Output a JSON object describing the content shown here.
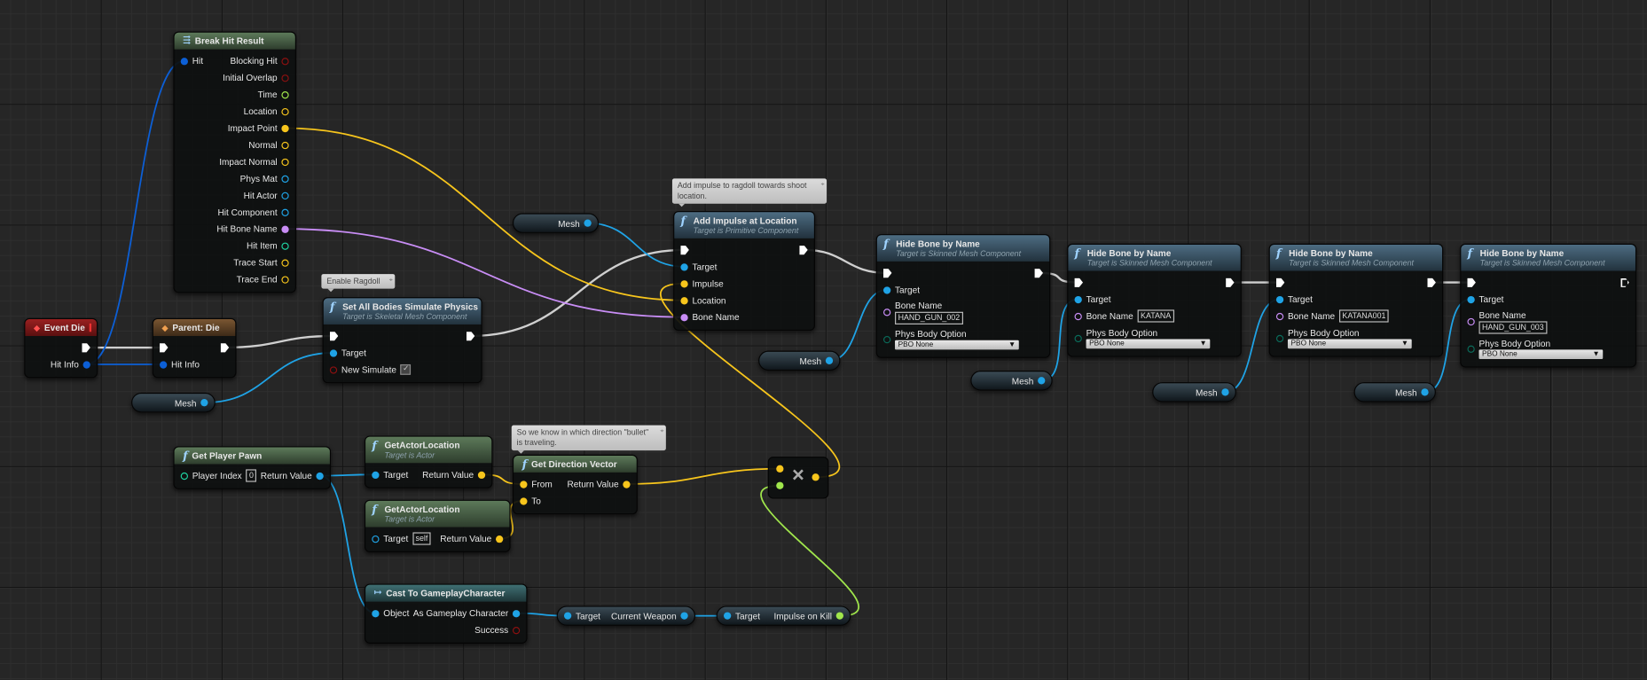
{
  "pin_colors": {
    "exec": "#ffffff",
    "struct": "#0c5fd6",
    "object": "#1fa3e6",
    "vector": "#f7c51c",
    "name": "#c88df5",
    "float": "#a0e64c",
    "bool": "#8b1010",
    "int": "#1fd1a0",
    "enum": "#0a6b5a"
  },
  "nodes": [
    {
      "id": "brk",
      "kind": "pure",
      "icon": "break-struct-icon",
      "title": "Break Hit Result",
      "subtitle": "",
      "inputs": [
        {
          "label": "Hit",
          "type": "struct",
          "filled": true
        }
      ],
      "outputs": [
        {
          "label": "Blocking Hit",
          "type": "bool"
        },
        {
          "label": "Initial Overlap",
          "type": "bool"
        },
        {
          "label": "Time",
          "type": "float"
        },
        {
          "label": "Location",
          "type": "vector"
        },
        {
          "label": "Impact Point",
          "type": "vector",
          "filled": true
        },
        {
          "label": "Normal",
          "type": "vector"
        },
        {
          "label": "Impact Normal",
          "type": "vector"
        },
        {
          "label": "Phys Mat",
          "type": "object"
        },
        {
          "label": "Hit Actor",
          "type": "object"
        },
        {
          "label": "Hit Component",
          "type": "object"
        },
        {
          "label": "Hit Bone Name",
          "type": "name",
          "filled": true
        },
        {
          "label": "Hit Item",
          "type": "int"
        },
        {
          "label": "Trace Start",
          "type": "vector"
        },
        {
          "label": "Trace End",
          "type": "vector"
        }
      ]
    },
    {
      "id": "evt",
      "kind": "event",
      "icon": "event-icon",
      "title": "Event Die",
      "subtitle": "",
      "inputs": [],
      "outputs": [
        {
          "label": "",
          "type": "exec",
          "filled": true
        },
        {
          "label": "Hit Info",
          "type": "struct",
          "filled": true
        }
      ]
    },
    {
      "id": "par",
      "kind": "parent",
      "icon": "parent-call-icon",
      "title": "Parent: Die",
      "subtitle": "",
      "inputs": [
        {
          "label": "",
          "type": "exec",
          "filled": true
        },
        {
          "label": "Hit Info",
          "type": "struct",
          "filled": true
        }
      ],
      "outputs": [
        {
          "label": "",
          "type": "exec",
          "filled": true
        }
      ]
    },
    {
      "id": "sim",
      "kind": "func",
      "icon": "function-icon",
      "title": "Set All Bodies Simulate Physics",
      "subtitle": "Target is Skeletal Mesh Component",
      "inputs": [
        {
          "label": "",
          "type": "exec",
          "filled": true
        },
        {
          "label": "Target",
          "type": "object",
          "filled": true
        },
        {
          "label": "New Simulate",
          "type": "bool",
          "checkbox": "✓"
        }
      ],
      "outputs": [
        {
          "label": "",
          "type": "exec",
          "filled": true
        }
      ]
    },
    {
      "id": "add",
      "kind": "func",
      "icon": "function-icon",
      "title": "Add Impulse at Location",
      "subtitle": "Target is Primitive Component",
      "inputs": [
        {
          "label": "",
          "type": "exec",
          "filled": true
        },
        {
          "label": "Target",
          "type": "object",
          "filled": true
        },
        {
          "label": "Impulse",
          "type": "vector",
          "filled": true
        },
        {
          "label": "Location",
          "type": "vector",
          "filled": true
        },
        {
          "label": "Bone Name",
          "type": "name",
          "filled": true
        }
      ],
      "outputs": [
        {
          "label": "",
          "type": "exec",
          "filled": true
        }
      ]
    },
    {
      "id": "h1",
      "kind": "func",
      "icon": "function-icon",
      "title": "Hide Bone by Name",
      "subtitle": "Target is Skinned Mesh Component",
      "inputs": [
        {
          "label": "",
          "type": "exec",
          "filled": true
        },
        {
          "label": "Target",
          "type": "object",
          "filled": true
        },
        {
          "label": "Bone Name",
          "type": "name",
          "value": "HAND_GUN_002",
          "block": true
        },
        {
          "label": "Phys Body Option",
          "type": "enum",
          "dropdown": "PBO None",
          "block": true
        }
      ],
      "outputs": [
        {
          "label": "",
          "type": "exec",
          "filled": true
        }
      ]
    },
    {
      "id": "h2",
      "kind": "func",
      "icon": "function-icon",
      "title": "Hide Bone by Name",
      "subtitle": "Target is Skinned Mesh Component",
      "inputs": [
        {
          "label": "",
          "type": "exec",
          "filled": true
        },
        {
          "label": "Target",
          "type": "object",
          "filled": true
        },
        {
          "label": "Bone Name",
          "type": "name",
          "value": "KATANA"
        },
        {
          "label": "Phys Body Option",
          "type": "enum",
          "dropdown": "PBO None",
          "block": true
        }
      ],
      "outputs": [
        {
          "label": "",
          "type": "exec",
          "filled": true
        }
      ]
    },
    {
      "id": "h3",
      "kind": "func",
      "icon": "function-icon",
      "title": "Hide Bone by Name",
      "subtitle": "Target is Skinned Mesh Component",
      "inputs": [
        {
          "label": "",
          "type": "exec",
          "filled": true
        },
        {
          "label": "Target",
          "type": "object",
          "filled": true
        },
        {
          "label": "Bone Name",
          "type": "name",
          "value": "KATANA001"
        },
        {
          "label": "Phys Body Option",
          "type": "enum",
          "dropdown": "PBO None",
          "block": true
        }
      ],
      "outputs": [
        {
          "label": "",
          "type": "exec",
          "filled": true
        }
      ]
    },
    {
      "id": "h4",
      "kind": "func",
      "icon": "function-icon",
      "title": "Hide Bone by Name",
      "subtitle": "Target is Skinned Mesh Component",
      "inputs": [
        {
          "label": "",
          "type": "exec",
          "filled": true
        },
        {
          "label": "Target",
          "type": "object",
          "filled": true
        },
        {
          "label": "Bone Name",
          "type": "name",
          "value": "HAND_GUN_003",
          "block": true
        },
        {
          "label": "Phys Body Option",
          "type": "enum",
          "dropdown": "PBO None",
          "block": true
        }
      ],
      "outputs": [
        {
          "label": "",
          "type": "exec",
          "filled": false
        }
      ]
    },
    {
      "id": "gpp",
      "kind": "pure",
      "icon": "function-icon",
      "title": "Get Player Pawn",
      "subtitle": "",
      "inputs": [
        {
          "label": "Player Index",
          "type": "int",
          "value": "0"
        }
      ],
      "outputs": [
        {
          "label": "Return Value",
          "type": "object",
          "filled": true
        }
      ]
    },
    {
      "id": "gal1",
      "kind": "pure",
      "icon": "function-icon",
      "title": "GetActorLocation",
      "subtitle": "Target is Actor",
      "inputs": [
        {
          "label": "Target",
          "type": "object",
          "filled": true
        }
      ],
      "outputs": [
        {
          "label": "Return Value",
          "type": "vector",
          "filled": true
        }
      ]
    },
    {
      "id": "gal2",
      "kind": "pure",
      "icon": "function-icon",
      "title": "GetActorLocation",
      "subtitle": "Target is Actor",
      "inputs": [
        {
          "label": "Target",
          "type": "object",
          "value": "self"
        }
      ],
      "outputs": [
        {
          "label": "Return Value",
          "type": "vector",
          "filled": true
        }
      ]
    },
    {
      "id": "gdv",
      "kind": "pure",
      "icon": "function-icon",
      "title": "Get Direction Vector",
      "subtitle": "",
      "inputs": [
        {
          "label": "From",
          "type": "vector",
          "filled": true
        },
        {
          "label": "To",
          "type": "vector",
          "filled": true
        }
      ],
      "outputs": [
        {
          "label": "Return Value",
          "type": "vector",
          "filled": true
        }
      ]
    },
    {
      "id": "cast",
      "kind": "cast",
      "icon": "cast-icon",
      "title": "Cast To GameplayCharacter",
      "subtitle": "",
      "inputs": [
        {
          "label": "Object",
          "type": "object",
          "filled": true
        }
      ],
      "outputs": [
        {
          "label": "As Gameplay Character",
          "type": "object",
          "filled": true
        },
        {
          "label": "Success",
          "type": "bool"
        }
      ]
    },
    {
      "id": "mul",
      "kind": "op",
      "icon": "multiply-icon",
      "symbol": "×",
      "inputs": [
        {
          "label": "",
          "type": "vector",
          "filled": true
        },
        {
          "label": "",
          "type": "float",
          "filled": true
        }
      ],
      "outputs": [
        {
          "label": "",
          "type": "vector",
          "filled": true
        }
      ]
    },
    {
      "id": "m1",
      "kind": "var",
      "inputs": [],
      "outputs": [
        {
          "label": "Mesh",
          "type": "object",
          "filled": true
        }
      ]
    },
    {
      "id": "m2",
      "kind": "var",
      "inputs": [],
      "outputs": [
        {
          "label": "Mesh",
          "type": "object",
          "filled": true
        }
      ]
    },
    {
      "id": "m3",
      "kind": "var",
      "inputs": [],
      "outputs": [
        {
          "label": "Mesh",
          "type": "object",
          "filled": true
        }
      ]
    },
    {
      "id": "m4",
      "kind": "var",
      "inputs": [],
      "outputs": [
        {
          "label": "Mesh",
          "type": "object",
          "filled": true
        }
      ]
    },
    {
      "id": "m5",
      "kind": "var",
      "inputs": [],
      "outputs": [
        {
          "label": "Mesh",
          "type": "object",
          "filled": true
        }
      ]
    },
    {
      "id": "m6",
      "kind": "var",
      "inputs": [],
      "outputs": [
        {
          "label": "Mesh",
          "type": "object",
          "filled": true
        }
      ]
    },
    {
      "id": "cw",
      "kind": "var",
      "inputs": [
        {
          "label": "Target",
          "type": "object",
          "filled": true
        }
      ],
      "outputs": [
        {
          "label": "Current Weapon",
          "type": "object",
          "filled": true
        }
      ]
    },
    {
      "id": "iok",
      "kind": "var",
      "inputs": [
        {
          "label": "Target",
          "type": "object",
          "filled": true
        }
      ],
      "outputs": [
        {
          "label": "Impulse on Kill",
          "type": "float",
          "filled": true
        }
      ]
    }
  ],
  "comments": [
    {
      "id": "c1",
      "text": "Enable Ragdoll"
    },
    {
      "id": "c2",
      "text": "Add impulse to ragdoll towards shoot location."
    },
    {
      "id": "c3",
      "text": "So we know in which direction \"bullet\" is traveling."
    }
  ],
  "connections": [
    {
      "from": "evt.out.0",
      "to": "par.in.0",
      "type": "exec"
    },
    {
      "from": "evt.out.1",
      "to": "par.in.1",
      "type": "struct"
    },
    {
      "from": "evt.out.1",
      "to": "brk.in.0",
      "type": "struct"
    },
    {
      "from": "par.out.0",
      "to": "sim.in.0",
      "type": "exec"
    },
    {
      "from": "sim.out.0",
      "to": "add.in.0",
      "type": "exec"
    },
    {
      "from": "add.out.0",
      "to": "h1.in.0",
      "type": "exec"
    },
    {
      "from": "h1.out.0",
      "to": "h2.in.0",
      "type": "exec"
    },
    {
      "from": "h2.out.0",
      "to": "h3.in.0",
      "type": "exec"
    },
    {
      "from": "h3.out.0",
      "to": "h4.in.0",
      "type": "exec"
    },
    {
      "from": "m1.out.0",
      "to": "sim.in.1",
      "type": "object"
    },
    {
      "from": "m2.out.0",
      "to": "add.in.1",
      "type": "object"
    },
    {
      "from": "m3.out.0",
      "to": "h1.in.1",
      "type": "object"
    },
    {
      "from": "m4.out.0",
      "to": "h2.in.1",
      "type": "object"
    },
    {
      "from": "m5.out.0",
      "to": "h3.in.1",
      "type": "object"
    },
    {
      "from": "m6.out.0",
      "to": "h4.in.1",
      "type": "object"
    },
    {
      "from": "brk.out.4",
      "to": "add.in.3",
      "type": "vector"
    },
    {
      "from": "brk.out.10",
      "to": "add.in.4",
      "type": "name"
    },
    {
      "from": "mul.out.0",
      "to": "add.in.2",
      "type": "vector"
    },
    {
      "from": "gpp.out.0",
      "to": "gal1.in.0",
      "type": "object"
    },
    {
      "from": "gpp.out.0",
      "to": "cast.in.0",
      "type": "object"
    },
    {
      "from": "gal1.out.0",
      "to": "gdv.in.0",
      "type": "vector"
    },
    {
      "from": "gal2.out.0",
      "to": "gdv.in.1",
      "type": "vector"
    },
    {
      "from": "gdv.out.0",
      "to": "mul.in.0",
      "type": "vector"
    },
    {
      "from": "cast.out.0",
      "to": "cw.in.0",
      "type": "object"
    },
    {
      "from": "cw.out.0",
      "to": "iok.in.0",
      "type": "object"
    },
    {
      "from": "iok.out.0",
      "to": "mul.in.1",
      "type": "float"
    }
  ]
}
